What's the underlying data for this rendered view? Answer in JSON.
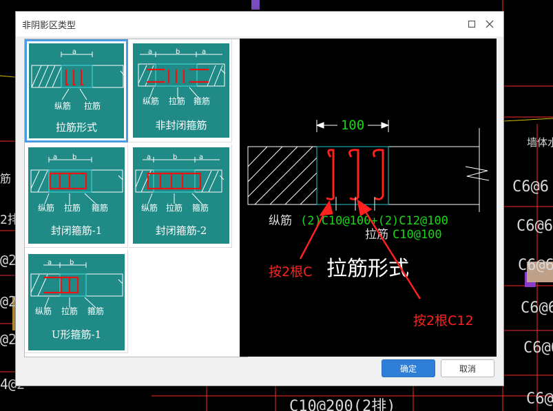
{
  "window": {
    "title": "非阴影区类型"
  },
  "background": {
    "texts": [
      "墙体水平",
      "C6@6",
      "C6@6",
      "C6@6",
      "C6@6",
      "C6@6",
      "C6@6",
      "C10@200(2排)",
      "筋",
      "2排",
      "@2",
      "@2",
      "@2",
      "0",
      "4@2"
    ]
  },
  "thumbnails": [
    {
      "label": "拉筋形式",
      "annotations": [
        "a",
        "纵筋",
        "拉筋"
      ],
      "selected": true
    },
    {
      "label": "非封闭箍筋",
      "annotations": [
        "a",
        "b",
        "a",
        "纵筋",
        "拉筋",
        "箍筋"
      ],
      "selected": false
    },
    {
      "label": "封闭箍筋-1",
      "annotations": [
        "a",
        "b",
        "纵筋",
        "拉筋",
        "箍筋"
      ],
      "selected": false
    },
    {
      "label": "封闭箍筋-2",
      "annotations": [
        "a",
        "b",
        "a",
        "纵筋",
        "拉筋",
        "箍筋"
      ],
      "selected": false
    },
    {
      "label": "U形箍筋-1",
      "annotations": [
        "a",
        "b",
        "纵筋",
        "拉筋",
        "箍筋"
      ],
      "selected": false
    }
  ],
  "preview": {
    "dimension": "100",
    "rebar_label_prefix": "纵筋",
    "rebar_spec": "(2)C10@100+(2)C12@100",
    "tie_label_prefix": "拉筋",
    "tie_spec": "C10@100",
    "caption": "拉筋形式",
    "annotation_left": "按2根C",
    "annotation_right": "按2根C12"
  },
  "buttons": {
    "ok": "确定",
    "cancel": "取消"
  },
  "colors": {
    "card": "#1f8a86",
    "selection": "#4b9be5",
    "primary": "#2f7fd9",
    "cad_green": "#18d818",
    "cad_cyan": "#1ec8c8",
    "cad_red": "#ff2020"
  }
}
